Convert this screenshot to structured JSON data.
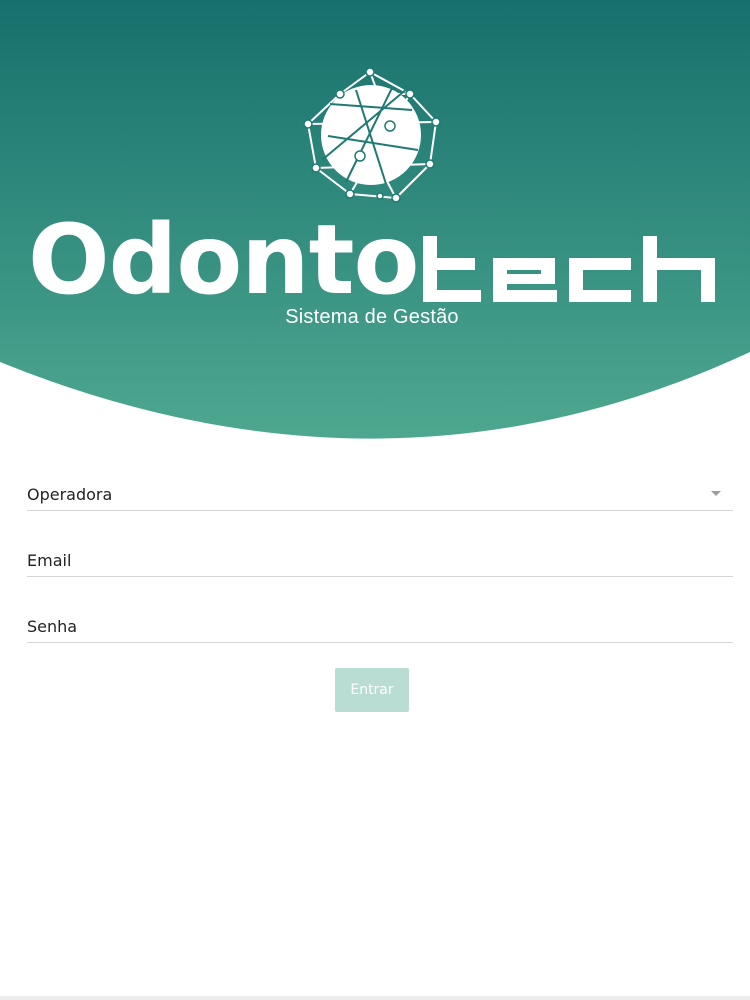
{
  "brand": {
    "name_part1": "Odonto",
    "name_part2": "tech",
    "subtitle": "Sistema de Gestão",
    "logo_icon": "globe-network-icon"
  },
  "colors": {
    "header_top": "#17706c",
    "header_bottom": "#4aa48e",
    "button_bg": "#b9ddd3",
    "underline": "#d6d6d6"
  },
  "form": {
    "operadora_label": "Operadora",
    "email_label": "Email",
    "senha_label": "Senha",
    "submit_label": "Entrar"
  }
}
